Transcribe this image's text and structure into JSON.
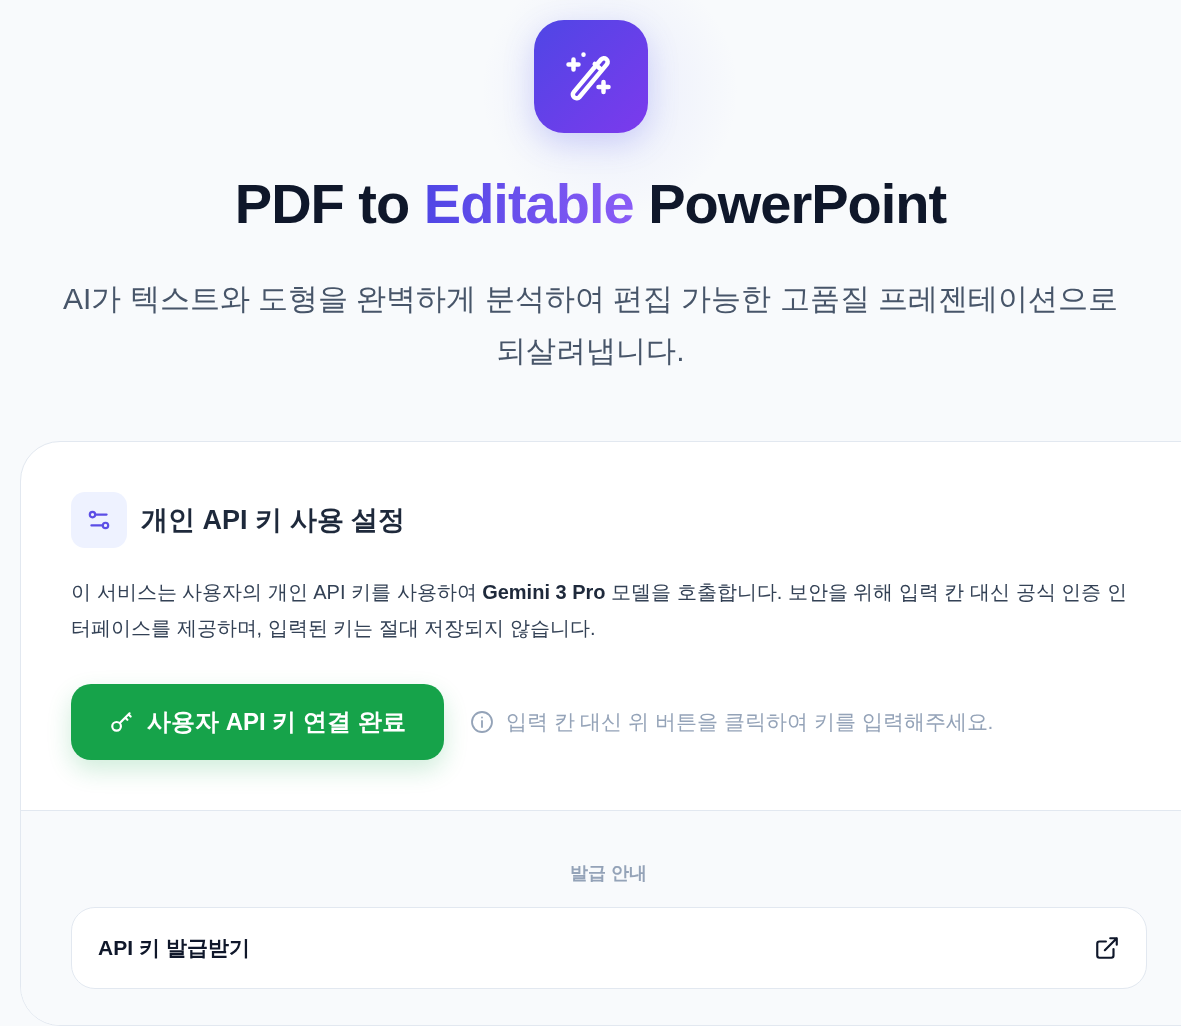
{
  "header": {
    "title_before": "PDF to ",
    "title_highlight": "Editable",
    "title_after": " PowerPoint",
    "subtitle": "AI가 텍스트와 도형을 완벽하게 분석하여 편집 가능한 고품질 프레젠테이션으로 되살려냅니다."
  },
  "settings": {
    "title": "개인 API 키 사용 설정",
    "description": "이 서비스는 사용자의 개인 API 키를 사용하여 **Gemini 3 Pro** 모델을 호출합니다. 보안을 위해 입력 칸 대신 공식 인증 인터페이스를 제공하며, 입력된 키는 절대 저장되지 않습니다.",
    "connect_button": {
      "label": "사용자 API 키 연결 완료",
      "connected": true
    },
    "hint": "입력 칸 대신 위 버튼을 클릭하여 키를 입력해주세요."
  },
  "guide": {
    "heading": "발급 안내",
    "links": [
      {
        "label": "API 키 발급받기"
      }
    ]
  }
}
